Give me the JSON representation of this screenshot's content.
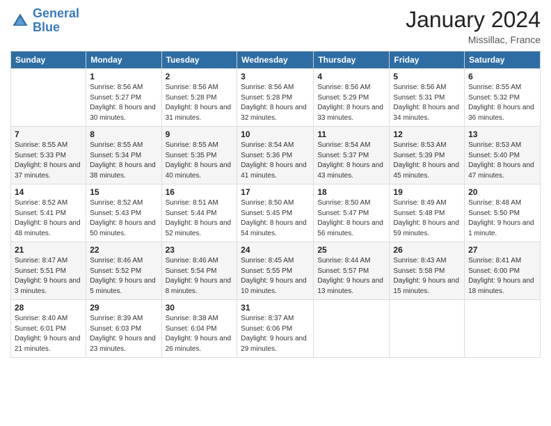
{
  "logo": {
    "line1": "General",
    "line2": "Blue"
  },
  "title": "January 2024",
  "location": "Missillac, France",
  "days_header": [
    "Sunday",
    "Monday",
    "Tuesday",
    "Wednesday",
    "Thursday",
    "Friday",
    "Saturday"
  ],
  "weeks": [
    [
      {
        "day": "",
        "sunrise": "",
        "sunset": "",
        "daylight": ""
      },
      {
        "day": "1",
        "sunrise": "Sunrise: 8:56 AM",
        "sunset": "Sunset: 5:27 PM",
        "daylight": "Daylight: 8 hours and 30 minutes."
      },
      {
        "day": "2",
        "sunrise": "Sunrise: 8:56 AM",
        "sunset": "Sunset: 5:28 PM",
        "daylight": "Daylight: 8 hours and 31 minutes."
      },
      {
        "day": "3",
        "sunrise": "Sunrise: 8:56 AM",
        "sunset": "Sunset: 5:28 PM",
        "daylight": "Daylight: 8 hours and 32 minutes."
      },
      {
        "day": "4",
        "sunrise": "Sunrise: 8:56 AM",
        "sunset": "Sunset: 5:29 PM",
        "daylight": "Daylight: 8 hours and 33 minutes."
      },
      {
        "day": "5",
        "sunrise": "Sunrise: 8:56 AM",
        "sunset": "Sunset: 5:31 PM",
        "daylight": "Daylight: 8 hours and 34 minutes."
      },
      {
        "day": "6",
        "sunrise": "Sunrise: 8:55 AM",
        "sunset": "Sunset: 5:32 PM",
        "daylight": "Daylight: 8 hours and 36 minutes."
      }
    ],
    [
      {
        "day": "7",
        "sunrise": "Sunrise: 8:55 AM",
        "sunset": "Sunset: 5:33 PM",
        "daylight": "Daylight: 8 hours and 37 minutes."
      },
      {
        "day": "8",
        "sunrise": "Sunrise: 8:55 AM",
        "sunset": "Sunset: 5:34 PM",
        "daylight": "Daylight: 8 hours and 38 minutes."
      },
      {
        "day": "9",
        "sunrise": "Sunrise: 8:55 AM",
        "sunset": "Sunset: 5:35 PM",
        "daylight": "Daylight: 8 hours and 40 minutes."
      },
      {
        "day": "10",
        "sunrise": "Sunrise: 8:54 AM",
        "sunset": "Sunset: 5:36 PM",
        "daylight": "Daylight: 8 hours and 41 minutes."
      },
      {
        "day": "11",
        "sunrise": "Sunrise: 8:54 AM",
        "sunset": "Sunset: 5:37 PM",
        "daylight": "Daylight: 8 hours and 43 minutes."
      },
      {
        "day": "12",
        "sunrise": "Sunrise: 8:53 AM",
        "sunset": "Sunset: 5:39 PM",
        "daylight": "Daylight: 8 hours and 45 minutes."
      },
      {
        "day": "13",
        "sunrise": "Sunrise: 8:53 AM",
        "sunset": "Sunset: 5:40 PM",
        "daylight": "Daylight: 8 hours and 47 minutes."
      }
    ],
    [
      {
        "day": "14",
        "sunrise": "Sunrise: 8:52 AM",
        "sunset": "Sunset: 5:41 PM",
        "daylight": "Daylight: 8 hours and 48 minutes."
      },
      {
        "day": "15",
        "sunrise": "Sunrise: 8:52 AM",
        "sunset": "Sunset: 5:43 PM",
        "daylight": "Daylight: 8 hours and 50 minutes."
      },
      {
        "day": "16",
        "sunrise": "Sunrise: 8:51 AM",
        "sunset": "Sunset: 5:44 PM",
        "daylight": "Daylight: 8 hours and 52 minutes."
      },
      {
        "day": "17",
        "sunrise": "Sunrise: 8:50 AM",
        "sunset": "Sunset: 5:45 PM",
        "daylight": "Daylight: 8 hours and 54 minutes."
      },
      {
        "day": "18",
        "sunrise": "Sunrise: 8:50 AM",
        "sunset": "Sunset: 5:47 PM",
        "daylight": "Daylight: 8 hours and 56 minutes."
      },
      {
        "day": "19",
        "sunrise": "Sunrise: 8:49 AM",
        "sunset": "Sunset: 5:48 PM",
        "daylight": "Daylight: 8 hours and 59 minutes."
      },
      {
        "day": "20",
        "sunrise": "Sunrise: 8:48 AM",
        "sunset": "Sunset: 5:50 PM",
        "daylight": "Daylight: 9 hours and 1 minute."
      }
    ],
    [
      {
        "day": "21",
        "sunrise": "Sunrise: 8:47 AM",
        "sunset": "Sunset: 5:51 PM",
        "daylight": "Daylight: 9 hours and 3 minutes."
      },
      {
        "day": "22",
        "sunrise": "Sunrise: 8:46 AM",
        "sunset": "Sunset: 5:52 PM",
        "daylight": "Daylight: 9 hours and 5 minutes."
      },
      {
        "day": "23",
        "sunrise": "Sunrise: 8:46 AM",
        "sunset": "Sunset: 5:54 PM",
        "daylight": "Daylight: 9 hours and 8 minutes."
      },
      {
        "day": "24",
        "sunrise": "Sunrise: 8:45 AM",
        "sunset": "Sunset: 5:55 PM",
        "daylight": "Daylight: 9 hours and 10 minutes."
      },
      {
        "day": "25",
        "sunrise": "Sunrise: 8:44 AM",
        "sunset": "Sunset: 5:57 PM",
        "daylight": "Daylight: 9 hours and 13 minutes."
      },
      {
        "day": "26",
        "sunrise": "Sunrise: 8:43 AM",
        "sunset": "Sunset: 5:58 PM",
        "daylight": "Daylight: 9 hours and 15 minutes."
      },
      {
        "day": "27",
        "sunrise": "Sunrise: 8:41 AM",
        "sunset": "Sunset: 6:00 PM",
        "daylight": "Daylight: 9 hours and 18 minutes."
      }
    ],
    [
      {
        "day": "28",
        "sunrise": "Sunrise: 8:40 AM",
        "sunset": "Sunset: 6:01 PM",
        "daylight": "Daylight: 9 hours and 21 minutes."
      },
      {
        "day": "29",
        "sunrise": "Sunrise: 8:39 AM",
        "sunset": "Sunset: 6:03 PM",
        "daylight": "Daylight: 9 hours and 23 minutes."
      },
      {
        "day": "30",
        "sunrise": "Sunrise: 8:38 AM",
        "sunset": "Sunset: 6:04 PM",
        "daylight": "Daylight: 9 hours and 26 minutes."
      },
      {
        "day": "31",
        "sunrise": "Sunrise: 8:37 AM",
        "sunset": "Sunset: 6:06 PM",
        "daylight": "Daylight: 9 hours and 29 minutes."
      },
      {
        "day": "",
        "sunrise": "",
        "sunset": "",
        "daylight": ""
      },
      {
        "day": "",
        "sunrise": "",
        "sunset": "",
        "daylight": ""
      },
      {
        "day": "",
        "sunrise": "",
        "sunset": "",
        "daylight": ""
      }
    ]
  ]
}
